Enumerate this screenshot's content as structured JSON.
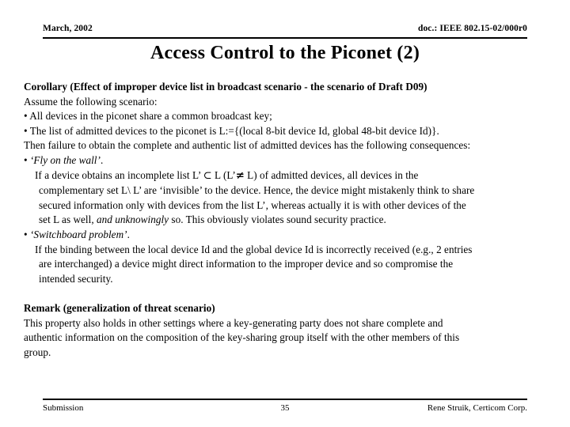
{
  "header": {
    "date": "March, 2002",
    "doc_id": "doc.: IEEE 802.15-02/000r0"
  },
  "title": "Access Control to the Piconet (2)",
  "body": {
    "corollary_heading": "Corollary (Effect of improper device list in broadcast scenario - the scenario of Draft D09)",
    "assume_line": "Assume the following scenario:",
    "bullet_1": "• All devices in the piconet share a common broadcast key;",
    "bullet_2": "• The list of admitted devices to the piconet is L:={(local 8-bit device Id, global 48-bit device Id)}.",
    "then_line": "Then failure to obtain the complete and authentic list of admitted devices has the following consequences:",
    "fly_bullet_prefix": "• ",
    "fly_bullet_italic": "‘Fly on the wall’",
    "fly_bullet_suffix": ".",
    "fly_line_1_a": "If a device obtains an incomplete list L’ ",
    "fly_line_1_subset": "⊂",
    "fly_line_1_b": " L (L’",
    "fly_line_1_neq": "≠",
    "fly_line_1_c": " L) of admitted devices, all devices in the",
    "fly_line_2": "complementary set L\\ L’ are ‘invisible’ to the device. Hence, the device might mistakenly think to share",
    "fly_line_3": "secured information only with devices from the list L’,  whereas actually it is with other devices of the",
    "fly_line_4_a": "set L as well, ",
    "fly_line_4_italic": "and unknowingly",
    "fly_line_4_b": " so. This obviously violates sound security practice.",
    "switchboard_bullet_prefix": "• ",
    "switchboard_bullet_italic": "‘Switchboard problem’",
    "switchboard_bullet_suffix": ".",
    "switchboard_line_1": "If the binding between the local device Id and the global device Id is incorrectly received (e.g., 2 entries",
    "switchboard_line_2": "are interchanged) a device might direct information to the improper device and so compromise the",
    "switchboard_line_3": "intended security.",
    "remark_heading": "Remark (generalization of threat scenario)",
    "remark_line_1": "This property also holds in other settings where a key-generating party does not share complete and",
    "remark_line_2": "authentic information on the composition of the key-sharing group itself with the other members of this",
    "remark_line_3": "group."
  },
  "footer": {
    "left": "Submission",
    "page_number": "35",
    "right": "Rene Struik, Certicom Corp."
  }
}
